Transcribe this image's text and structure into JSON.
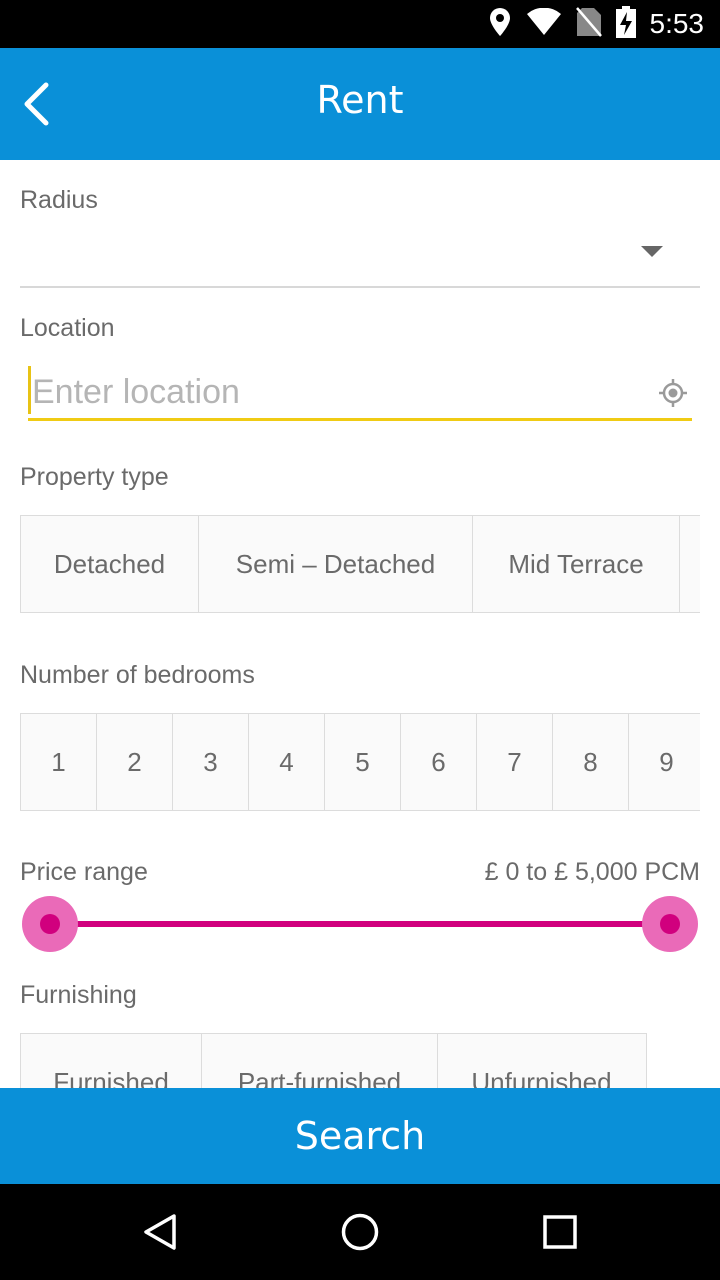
{
  "status_bar": {
    "time": "5:53",
    "icons": [
      "location-icon",
      "wifi-icon",
      "no-sim-icon",
      "battery-charging-icon"
    ]
  },
  "app_bar": {
    "title": "Rent",
    "back_icon": "chevron-left-icon"
  },
  "colors": {
    "primary": "#0a90d8",
    "accent": "#f0cb14",
    "slider": "#d1007e",
    "slider_thumb": "#ea6ab8"
  },
  "form": {
    "radius": {
      "label": "Radius",
      "value": ""
    },
    "location": {
      "label": "Location",
      "placeholder": "Enter location",
      "value": ""
    },
    "property_type": {
      "label": "Property type",
      "options": [
        "Detached",
        "Semi – Detached",
        "Mid Terrace"
      ]
    },
    "bedrooms": {
      "label": "Number of bedrooms",
      "options": [
        "1",
        "2",
        "3",
        "4",
        "5",
        "6",
        "7",
        "8",
        "9"
      ]
    },
    "price_range": {
      "label": "Price range",
      "value_text": "£ 0 to £ 5,000 PCM",
      "min": 0,
      "max": 5000,
      "low": 0,
      "high": 5000
    },
    "furnishing": {
      "label": "Furnishing",
      "options": [
        "Furnished",
        "Part-furnished",
        "Unfurnished"
      ]
    }
  },
  "search_button": {
    "label": "Search"
  },
  "nav_bar": {
    "back": "triangle-back-icon",
    "home": "circle-home-icon",
    "recents": "square-recents-icon"
  }
}
